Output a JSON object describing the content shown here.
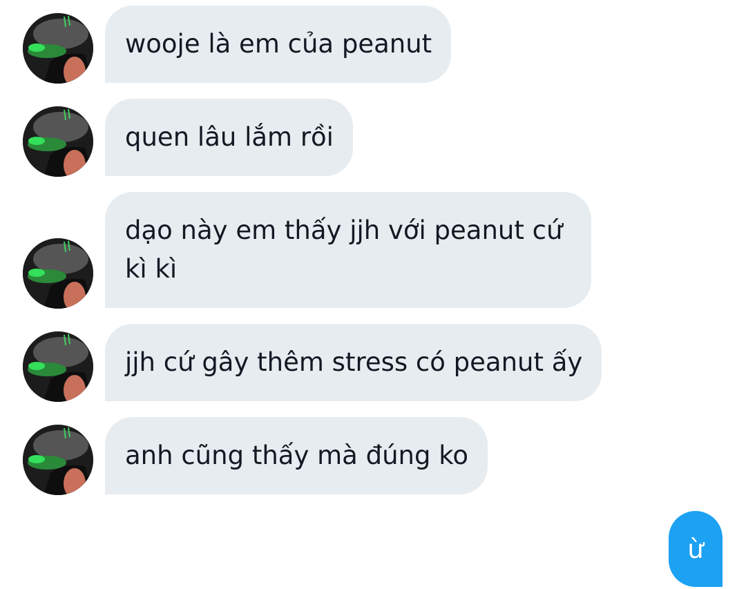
{
  "conversation": {
    "incoming": [
      {
        "text": "wooje là em của peanut",
        "avatar": "user-avatar"
      },
      {
        "text": "quen lâu lắm rồi",
        "avatar": "user-avatar"
      },
      {
        "text": "dạo này em thấy jjh với peanut cứ kì kì",
        "avatar": "user-avatar"
      },
      {
        "text": "jjh cứ gây thêm stress có peanut ấy",
        "avatar": "user-avatar"
      },
      {
        "text": "anh cũng thấy mà đúng ko",
        "avatar": "user-avatar"
      }
    ],
    "outgoing": [
      {
        "text": "ừ"
      }
    ]
  },
  "colors": {
    "incoming_bubble": "#e7ecf0",
    "incoming_text": "#141823",
    "outgoing_bubble": "#1da1f2",
    "outgoing_text": "#ffffff",
    "background": "#ffffff"
  }
}
